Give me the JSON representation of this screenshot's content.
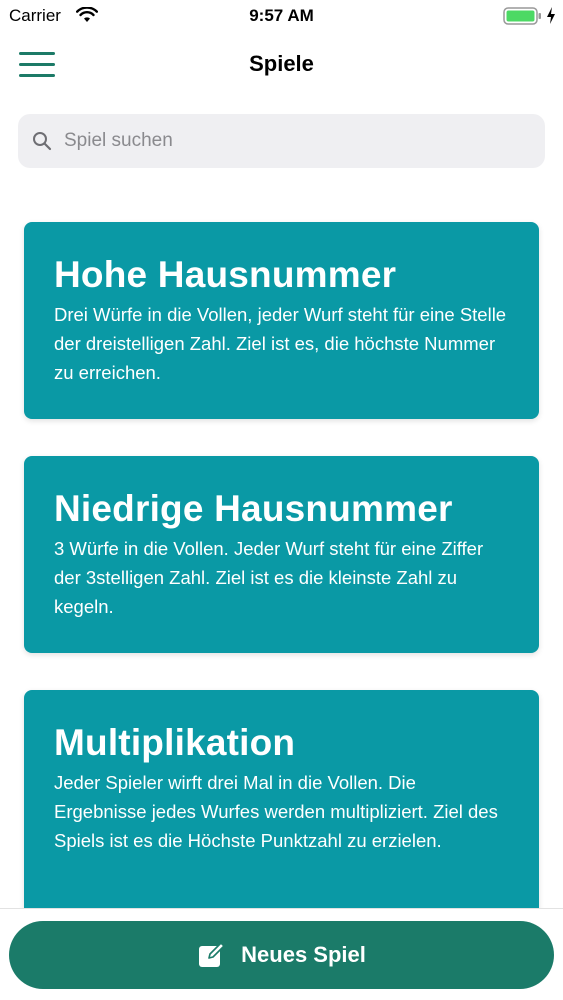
{
  "status_bar": {
    "carrier": "Carrier",
    "time": "9:57 AM",
    "battery_color": "#4cd964"
  },
  "nav": {
    "title": "Spiele",
    "accent_color": "#1c7a67"
  },
  "search": {
    "placeholder": "Spiel suchen",
    "value": ""
  },
  "games": [
    {
      "title": "Hohe Hausnummer",
      "description": "Drei Würfe in die Vollen, jeder Wurf steht für eine Stelle der dreistelligen Zahl. Ziel ist es, die höchste Nummer zu erreichen."
    },
    {
      "title": "Niedrige Hausnummer",
      "description": "3 Würfe in die Vollen. Jeder Wurf steht für eine Ziffer der 3stelligen Zahl. Ziel ist es die kleinste Zahl zu kegeln."
    },
    {
      "title": "Multiplikation",
      "description": "Jeder Spieler wirft drei Mal in die Vollen. Die Ergebnisse jedes Wurfes werden multipliziert. Ziel des Spiels ist es die Höchste Punktzahl zu erzielen."
    }
  ],
  "card_color": "#0a99a5",
  "bottom": {
    "button_label": "Neues Spiel",
    "button_icon": "edit-icon",
    "button_color": "#1b7b69"
  }
}
